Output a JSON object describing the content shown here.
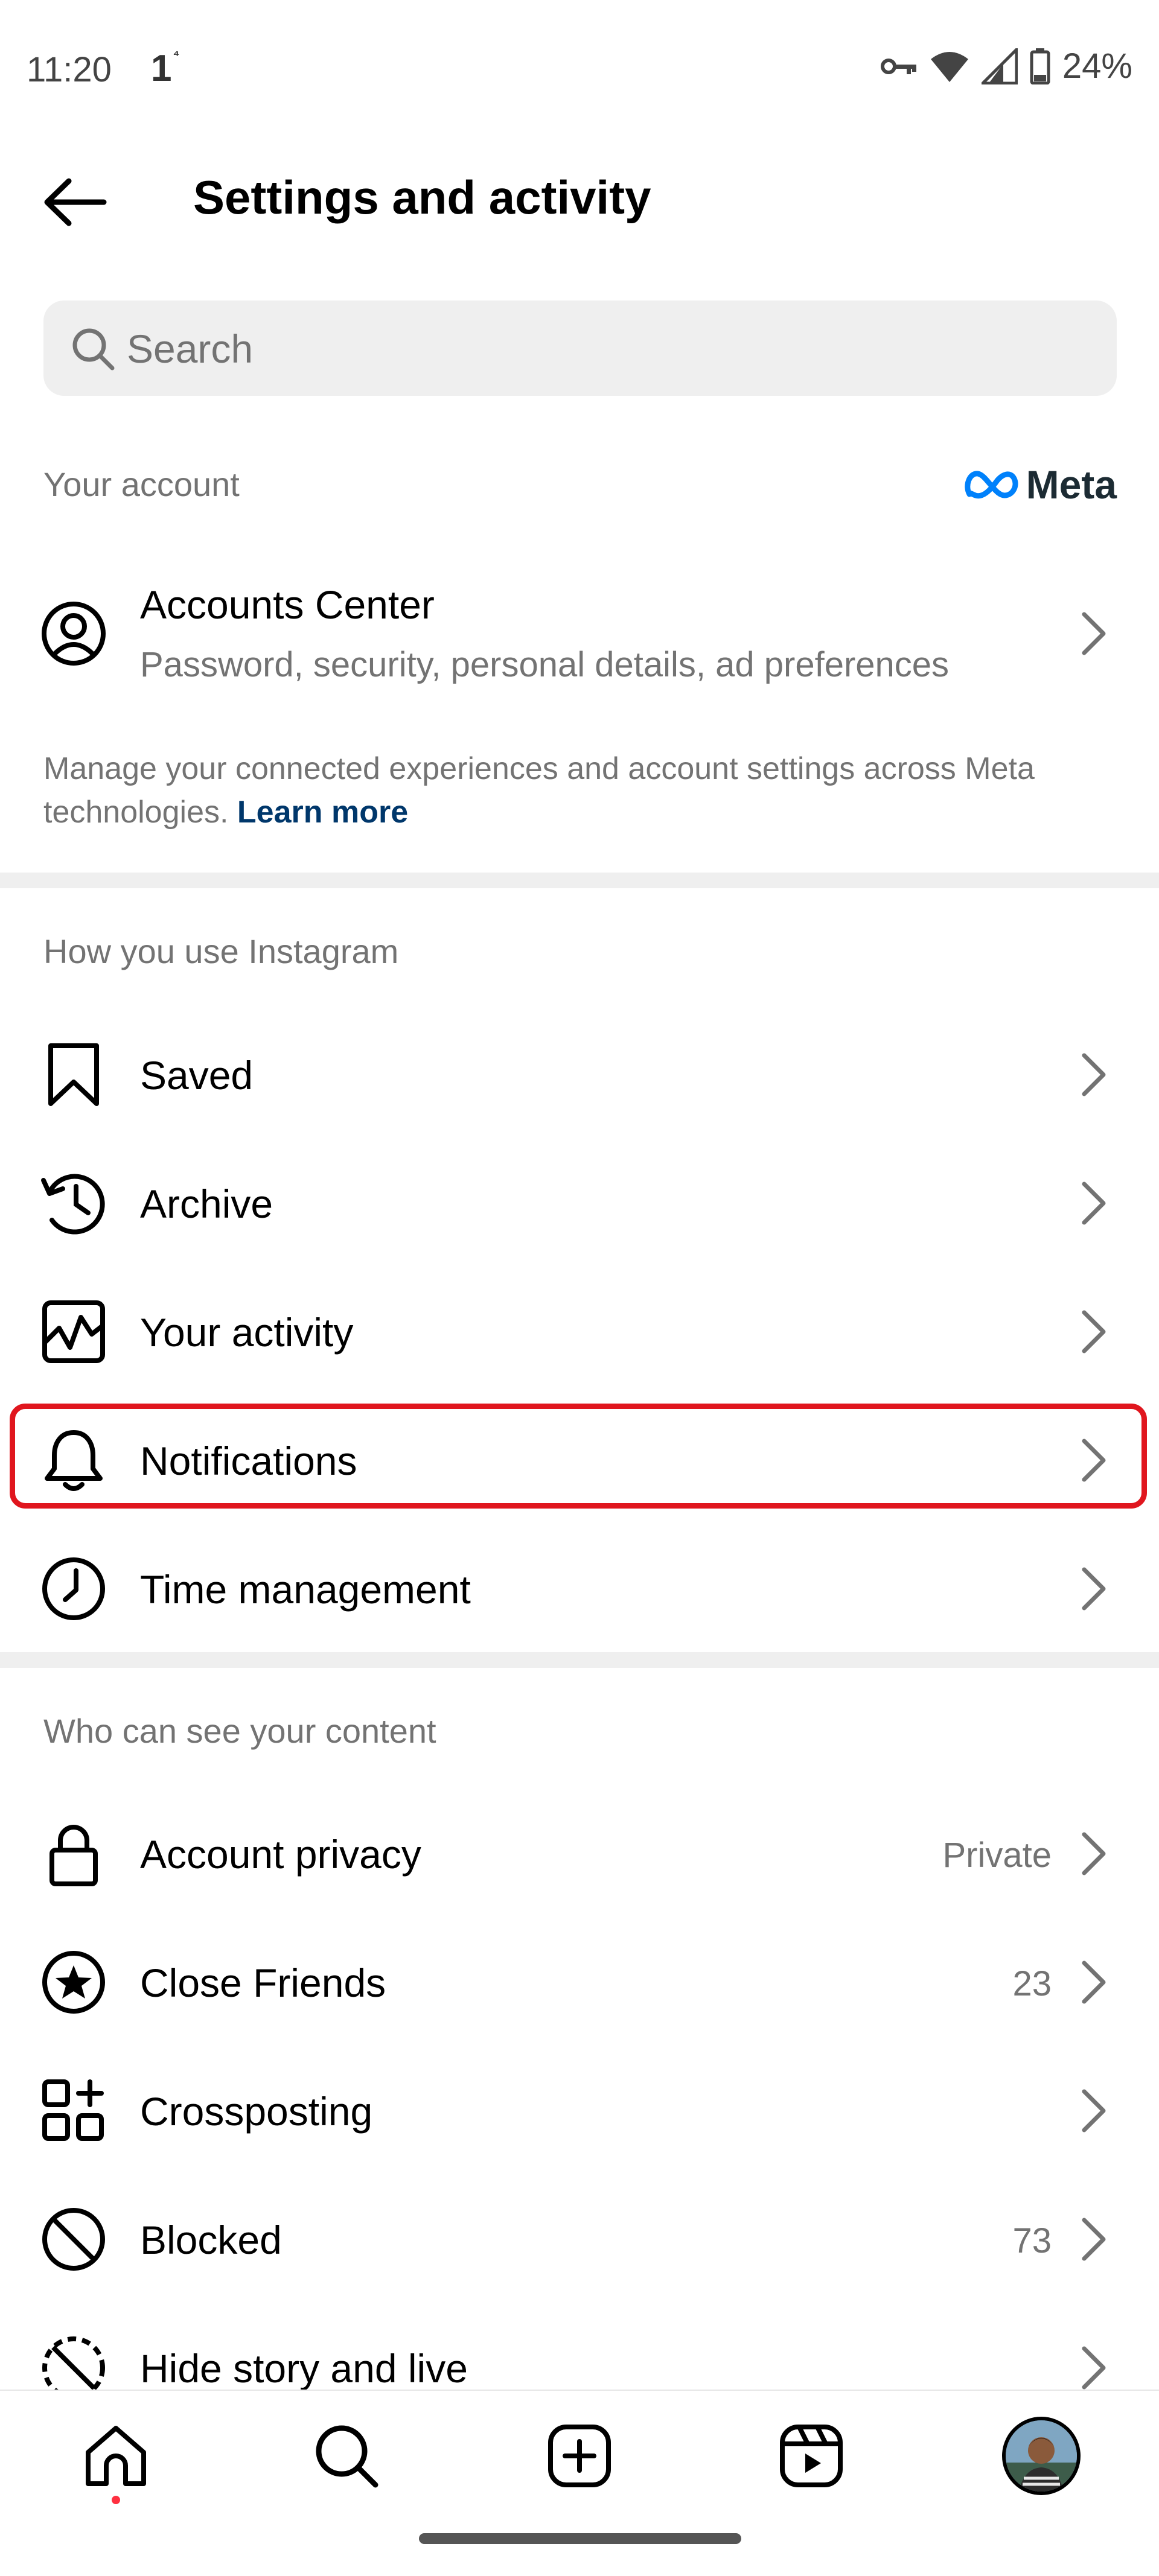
{
  "status_bar": {
    "time": "11:20",
    "indicator": "1",
    "indicator_sup": "⁴",
    "battery": "24%"
  },
  "header": {
    "title": "Settings and activity"
  },
  "search": {
    "placeholder": "Search"
  },
  "your_account": {
    "label": "Your account",
    "brand": "Meta",
    "accounts_center": {
      "title": "Accounts Center",
      "subtitle": "Password, security, personal details, ad preferences"
    },
    "helper_text": "Manage your connected experiences and account settings across Meta technologies.",
    "learn_more": "Learn more"
  },
  "how_you_use": {
    "label": "How you use Instagram",
    "items": [
      {
        "label": "Saved",
        "icon": "bookmark-icon"
      },
      {
        "label": "Archive",
        "icon": "archive-icon"
      },
      {
        "label": "Your activity",
        "icon": "activity-icon"
      },
      {
        "label": "Notifications",
        "icon": "bell-icon"
      },
      {
        "label": "Time management",
        "icon": "clock-icon"
      }
    ]
  },
  "who_can_see": {
    "label": "Who can see your content",
    "items": [
      {
        "label": "Account privacy",
        "value": "Private",
        "icon": "lock-icon"
      },
      {
        "label": "Close Friends",
        "value": "23",
        "icon": "star-circle-icon"
      },
      {
        "label": "Crossposting",
        "value": "",
        "icon": "crosspost-icon"
      },
      {
        "label": "Blocked",
        "value": "73",
        "icon": "blocked-icon"
      },
      {
        "label": "Hide story and live",
        "value": "",
        "icon": "hide-story-icon"
      }
    ]
  },
  "colors": {
    "highlight": "#e0161e",
    "link": "#00376b",
    "secondary_text": "#737373",
    "meta_blue": "#0081fb"
  }
}
